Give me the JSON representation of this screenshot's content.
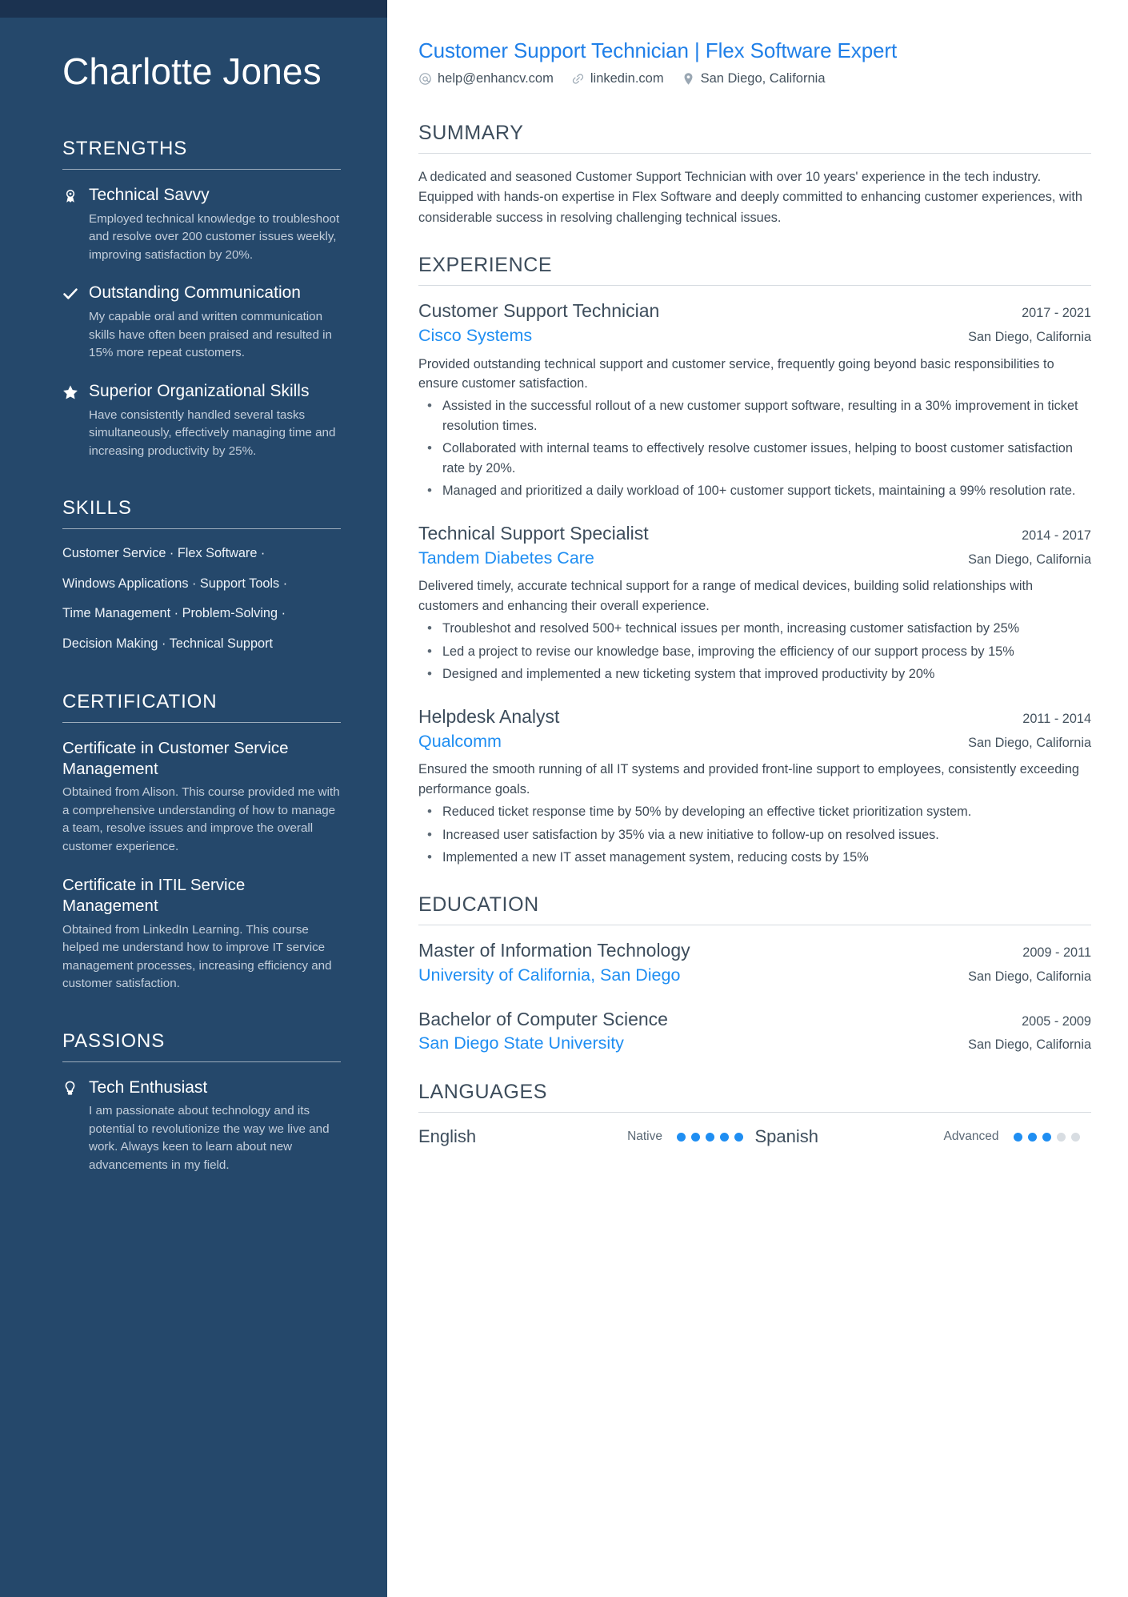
{
  "colors": {
    "sidebar_bg": "#25486b",
    "sidebar_top_strip": "#1b3250",
    "accent_blue": "#1f8ef2",
    "headline_blue": "#1f7fe8",
    "body_text": "#3f4b57"
  },
  "sidebar": {
    "name": "Charlotte Jones",
    "strengths": {
      "title": "STRENGTHS",
      "items": [
        {
          "icon": "award-ribbon-icon",
          "title": "Technical Savvy",
          "desc": "Employed technical knowledge to troubleshoot and resolve over 200 customer issues weekly, improving satisfaction by 20%."
        },
        {
          "icon": "check-icon",
          "title": "Outstanding Communication",
          "desc": "My capable oral and written communication skills have often been praised and resulted in 15% more repeat customers."
        },
        {
          "icon": "star-icon",
          "title": "Superior Organizational Skills",
          "desc": "Have consistently handled several tasks simultaneously, effectively managing time and increasing productivity by 25%."
        }
      ]
    },
    "skills": {
      "title": "SKILLS",
      "lines": [
        "Customer Service · Flex Software ·",
        "Windows Applications · Support Tools ·",
        "Time Management · Problem-Solving ·",
        "Decision Making · Technical Support"
      ]
    },
    "certification": {
      "title": "CERTIFICATION",
      "items": [
        {
          "title": "Certificate in Customer Service Management",
          "desc": "Obtained from Alison. This course provided me with a comprehensive understanding of how to manage a team, resolve issues and improve the overall customer experience."
        },
        {
          "title": "Certificate in ITIL Service Management",
          "desc": "Obtained from LinkedIn Learning. This course helped me understand how to improve IT service management processes, increasing efficiency and customer satisfaction."
        }
      ]
    },
    "passions": {
      "title": "PASSIONS",
      "items": [
        {
          "icon": "lightbulb-icon",
          "title": "Tech Enthusiast",
          "desc": "I am passionate about technology and its potential to revolutionize the way we live and work. Always keen to learn about new advancements in my field."
        }
      ]
    }
  },
  "main": {
    "headline": "Customer Support Technician | Flex Software Expert",
    "contacts": [
      {
        "icon": "at-email-icon",
        "text": "help@enhancv.com"
      },
      {
        "icon": "link-chain-icon",
        "text": "linkedin.com"
      },
      {
        "icon": "location-pin-icon",
        "text": "San Diego, California"
      }
    ],
    "summary": {
      "title": "SUMMARY",
      "text": "A dedicated and seasoned Customer Support Technician with over 10 years' experience in the tech industry. Equipped with hands-on expertise in Flex Software and deeply committed to enhancing customer experiences, with considerable success in resolving challenging technical issues."
    },
    "experience": {
      "title": "EXPERIENCE",
      "entries": [
        {
          "role": "Customer Support Technician",
          "date": "2017 - 2021",
          "company": "Cisco Systems",
          "location": "San Diego, California",
          "desc": "Provided outstanding technical support and customer service, frequently going beyond basic responsibilities to ensure customer satisfaction.",
          "bullets": [
            "Assisted in the successful rollout of a new customer support software, resulting in a 30% improvement in ticket resolution times.",
            "Collaborated with internal teams to effectively resolve customer issues, helping to boost customer satisfaction rate by 20%.",
            "Managed and prioritized a daily workload of 100+ customer support tickets, maintaining a 99% resolution rate."
          ]
        },
        {
          "role": "Technical Support Specialist",
          "date": "2014 - 2017",
          "company": "Tandem Diabetes Care",
          "location": "San Diego, California",
          "desc": "Delivered timely, accurate technical support for a range of medical devices, building solid relationships with customers and enhancing their overall experience.",
          "bullets": [
            "Troubleshot and resolved 500+ technical issues per month, increasing customer satisfaction by 25%",
            "Led a project to revise our knowledge base, improving the efficiency of our support process by 15%",
            "Designed and implemented a new ticketing system that improved productivity by 20%"
          ]
        },
        {
          "role": "Helpdesk Analyst",
          "date": "2011 - 2014",
          "company": "Qualcomm",
          "location": "San Diego, California",
          "desc": "Ensured the smooth running of all IT systems and provided front-line support to employees, consistently exceeding performance goals.",
          "bullets": [
            "Reduced ticket response time by 50% by developing an effective ticket prioritization system.",
            "Increased user satisfaction by 35% via a new initiative to follow-up on resolved issues.",
            "Implemented a new IT asset management system, reducing costs by 15%"
          ]
        }
      ]
    },
    "education": {
      "title": "EDUCATION",
      "entries": [
        {
          "degree": "Master of Information Technology",
          "date": "2009 - 2011",
          "school": "University of California, San Diego",
          "location": "San Diego, California"
        },
        {
          "degree": "Bachelor of Computer Science",
          "date": "2005 - 2009",
          "school": "San Diego State University",
          "location": "San Diego, California"
        }
      ]
    },
    "languages": {
      "title": "LANGUAGES",
      "items": [
        {
          "name": "English",
          "level": "Native",
          "filled": 5,
          "total": 5
        },
        {
          "name": "Spanish",
          "level": "Advanced",
          "filled": 3,
          "total": 5
        }
      ]
    }
  }
}
